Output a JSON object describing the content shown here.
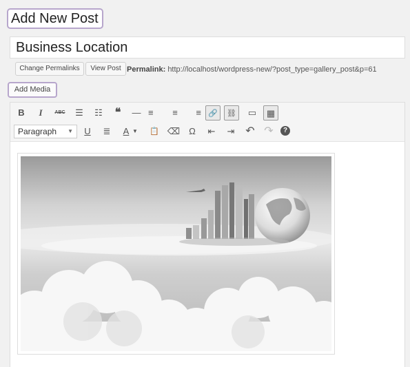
{
  "page": {
    "title": "Add New Post"
  },
  "post": {
    "title": "Business Location"
  },
  "permalink": {
    "change_label": "Change Permalinks",
    "view_label": "View Post",
    "label": "Permalink:",
    "url": "http://localhost/wordpress-new/?post_type=gallery_post&p=61"
  },
  "media": {
    "add_label": "Add Media"
  },
  "toolbar": {
    "row1": [
      {
        "name": "bold-button",
        "glyph": "B"
      },
      {
        "name": "italic-button",
        "glyph": "I"
      },
      {
        "name": "strikethrough-button",
        "glyph": "ABC"
      },
      {
        "name": "bulleted-list-button",
        "glyph": "☰"
      },
      {
        "name": "numbered-list-button",
        "glyph": "☷"
      },
      {
        "name": "blockquote-button",
        "glyph": "❝"
      },
      {
        "name": "horizontal-line-button",
        "glyph": "—"
      },
      {
        "name": "align-left-button",
        "glyph": "≡"
      },
      {
        "name": "align-center-button",
        "glyph": "≡"
      },
      {
        "name": "align-right-button",
        "glyph": "≡"
      },
      {
        "name": "insert-link-button",
        "glyph": "🔗"
      },
      {
        "name": "remove-link-button",
        "glyph": "⛓"
      },
      {
        "name": "read-more-button",
        "glyph": "▭"
      },
      {
        "name": "toolbar-toggle-button",
        "glyph": "▦"
      }
    ],
    "format_select": "Paragraph",
    "row2": [
      {
        "name": "underline-button",
        "glyph": "U"
      },
      {
        "name": "justify-button",
        "glyph": "≣"
      },
      {
        "name": "text-color-button",
        "glyph": "A"
      },
      {
        "name": "paste-text-button",
        "glyph": "📋"
      },
      {
        "name": "clear-formatting-button",
        "glyph": "⌫"
      },
      {
        "name": "special-character-button",
        "glyph": "Ω"
      },
      {
        "name": "outdent-button",
        "glyph": "⇤"
      },
      {
        "name": "indent-button",
        "glyph": "⇥"
      },
      {
        "name": "undo-button",
        "glyph": "↶"
      },
      {
        "name": "redo-button",
        "glyph": "↷"
      },
      {
        "name": "help-button",
        "glyph": "?"
      }
    ]
  }
}
